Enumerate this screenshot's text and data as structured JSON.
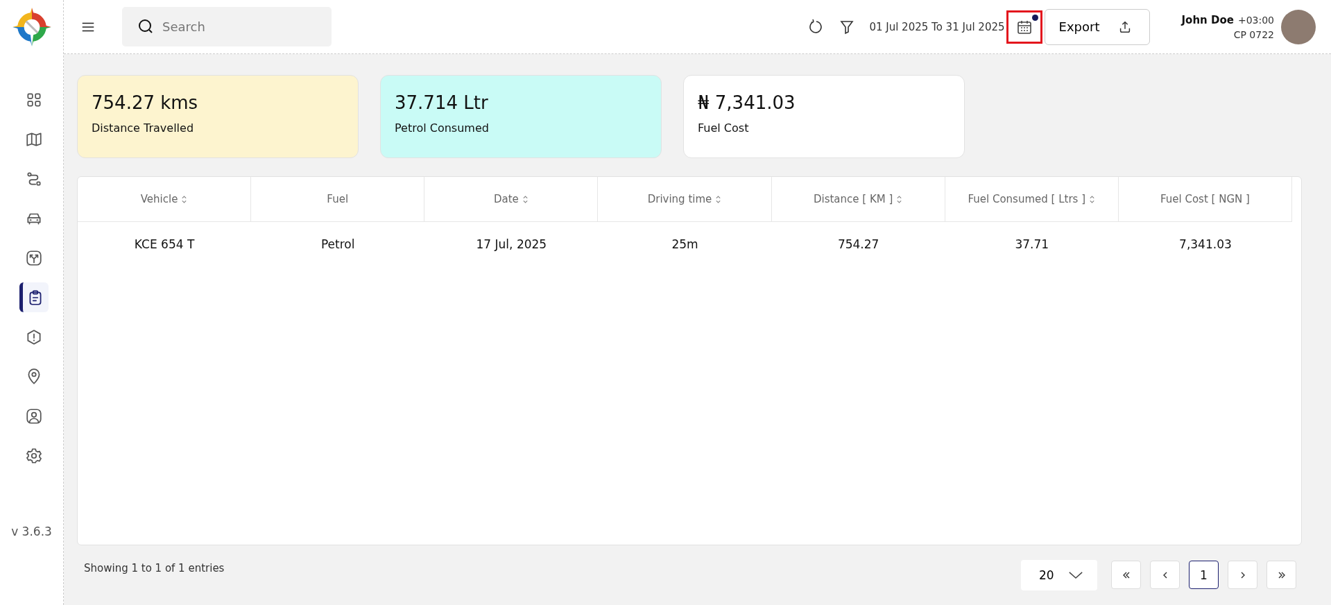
{
  "sidebar": {
    "items": [
      {
        "kind": "grid",
        "selected": false
      },
      {
        "kind": "map",
        "selected": false
      },
      {
        "kind": "route",
        "selected": false
      },
      {
        "kind": "car",
        "selected": false
      },
      {
        "kind": "fork",
        "selected": false
      },
      {
        "kind": "report",
        "selected": true
      },
      {
        "kind": "alert",
        "selected": false
      },
      {
        "kind": "pin",
        "selected": false
      },
      {
        "kind": "user",
        "selected": false
      },
      {
        "kind": "gear",
        "selected": false
      }
    ],
    "version": "v 3.6.3"
  },
  "topbar": {
    "search": {
      "placeholder": "Search"
    },
    "date_range": "01 Jul 2025 To 31 Jul 2025",
    "calendar": {
      "highlighted": true,
      "indicator": true
    },
    "export_label": "Export",
    "user": {
      "name": "John Doe",
      "timezone": "+03:00",
      "code": "CP 0722"
    }
  },
  "cards": [
    {
      "value": "754.27 kms",
      "label": "Distance Travelled",
      "color": "#fdf4cf"
    },
    {
      "value": "37.714 Ltr",
      "label": "Petrol Consumed",
      "color": "#c9fbf6"
    },
    {
      "value": "₦ 7,341.03",
      "label": "Fuel Cost",
      "color": "#ffffff"
    }
  ],
  "table": {
    "columns": [
      {
        "label": "Vehicle",
        "sortable": true
      },
      {
        "label": "Fuel",
        "sortable": false
      },
      {
        "label": "Date",
        "sortable": true
      },
      {
        "label": "Driving time",
        "sortable": true
      },
      {
        "label": "Distance [ KM ]",
        "sortable": true
      },
      {
        "label": "Fuel Consumed [ Ltrs ]",
        "sortable": true
      },
      {
        "label": "Fuel Cost [ NGN ]",
        "sortable": false
      }
    ],
    "rows": [
      [
        "KCE 654 T",
        "Petrol",
        "17 Jul, 2025",
        "25m",
        "754.27",
        "37.71",
        "7,341.03"
      ]
    ]
  },
  "footer": {
    "entries": "Showing 1 to 1 of 1 entries",
    "page_size": "20",
    "pages": [
      {
        "label": "1",
        "selected": true
      }
    ]
  }
}
